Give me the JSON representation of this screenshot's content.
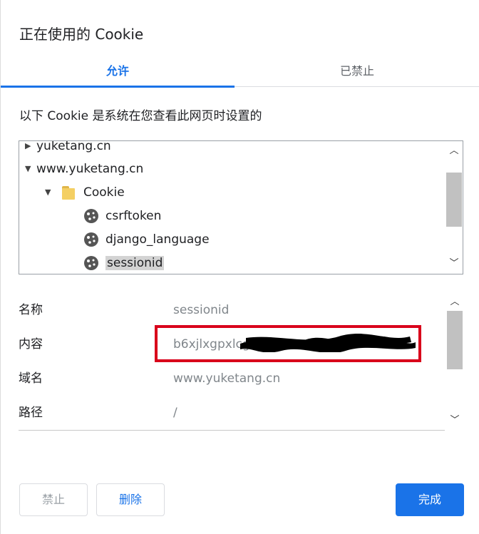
{
  "dialog": {
    "title": "正在使用的 Cookie",
    "tabs": [
      {
        "label": "允许",
        "active": true
      },
      {
        "label": "已禁止",
        "active": false
      }
    ],
    "description": "以下 Cookie 是系统在您查看此网页时设置的"
  },
  "tree": {
    "items": [
      {
        "label": "yuketang.cn",
        "expanded": false,
        "icon": "triangle-right-icon"
      },
      {
        "label": "www.yuketang.cn",
        "expanded": true,
        "icon": "triangle-down-icon"
      },
      {
        "label": "Cookie",
        "expanded": true,
        "icon": "folder-icon"
      },
      {
        "label": "csrftoken",
        "icon": "cookie-icon"
      },
      {
        "label": "django_language",
        "icon": "cookie-icon"
      },
      {
        "label": "sessionid",
        "icon": "cookie-icon",
        "selected": true
      }
    ]
  },
  "details": {
    "rows": [
      {
        "label": "名称",
        "value": "sessionid"
      },
      {
        "label": "内容",
        "value": "b6xjlxgpxlcg"
      },
      {
        "label": "域名",
        "value": "www.yuketang.cn"
      },
      {
        "label": "路径",
        "value": "/"
      }
    ]
  },
  "buttons": {
    "block": "禁止",
    "delete": "删除",
    "done": "完成"
  },
  "colors": {
    "accent": "#1a73e8",
    "highlight_box": "#d9001b",
    "selected_bg": "#d3d3d3"
  }
}
